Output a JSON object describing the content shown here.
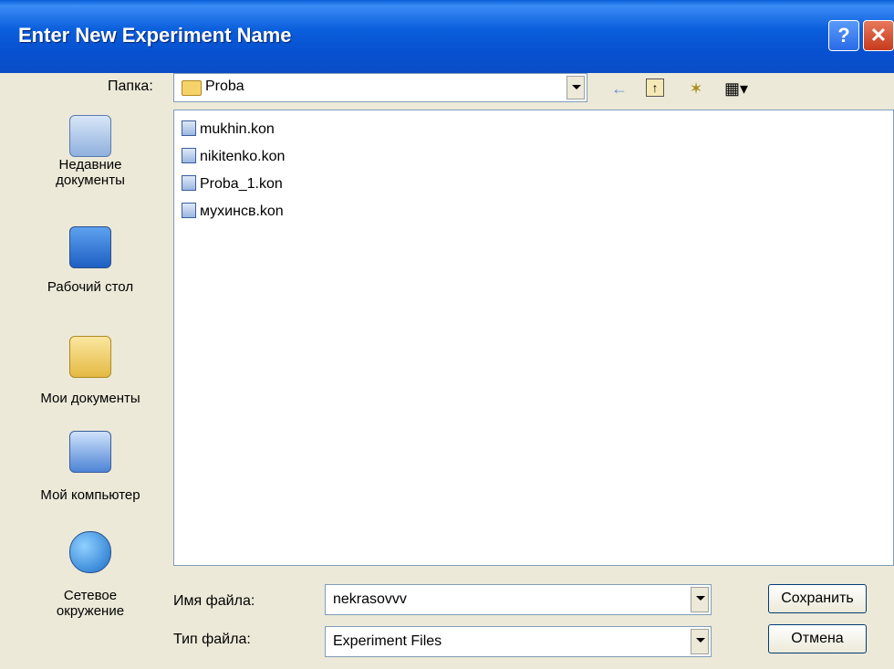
{
  "window": {
    "title": "Enter New Experiment Name",
    "help_glyph": "?",
    "close_glyph": "✕"
  },
  "folder": {
    "label": "Папка:",
    "value": "Proba"
  },
  "toolbar": {
    "back_icon": "back-arrow-icon",
    "up_icon": "up-folder-icon",
    "new_folder_icon": "new-folder-icon",
    "views_icon": "views-menu-icon"
  },
  "places": [
    {
      "label": "Недавние документы"
    },
    {
      "label": "Рабочий стол"
    },
    {
      "label": "Мои документы"
    },
    {
      "label": "Мой компьютер"
    },
    {
      "label": "Сетевое окружение"
    }
  ],
  "files": [
    {
      "name": "mukhin.kon"
    },
    {
      "name": "nikitenko.kon"
    },
    {
      "name": "Proba_1.kon"
    },
    {
      "name": "мухинсв.kon"
    }
  ],
  "filename": {
    "label": "Имя файла:",
    "value": "nekrasovvv"
  },
  "filetype": {
    "label": "Тип файла:",
    "value": "Experiment Files"
  },
  "buttons": {
    "save": "Сохранить",
    "cancel": "Отмена"
  },
  "colors": {
    "titlebar": "#0a5fd8",
    "dialog_bg": "#ece9d8"
  }
}
